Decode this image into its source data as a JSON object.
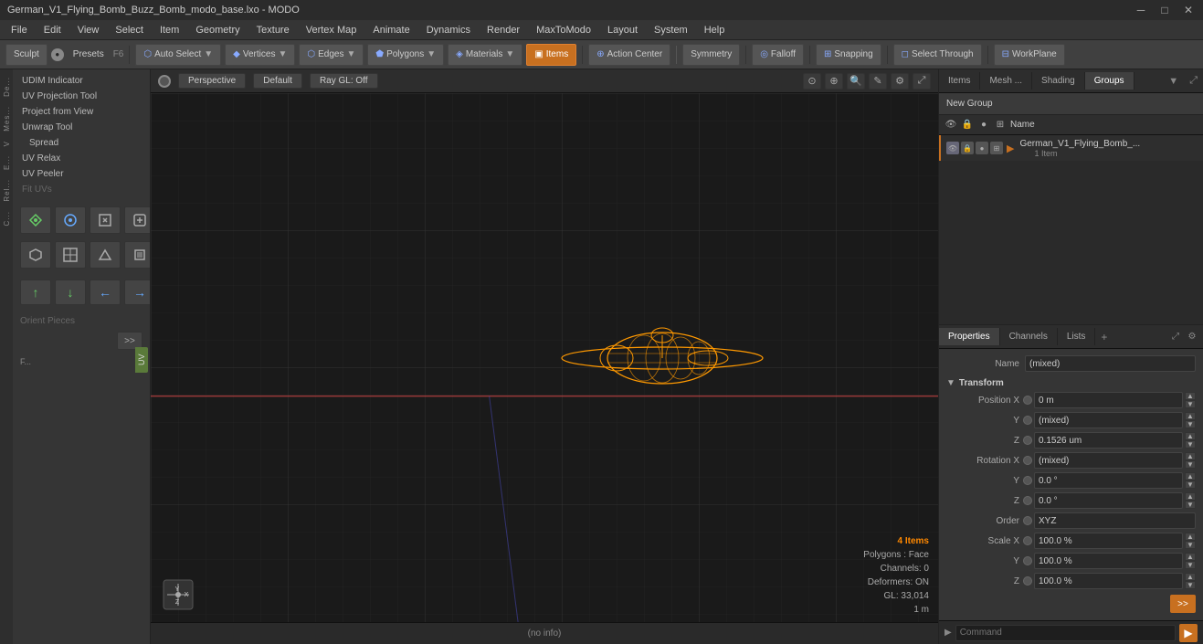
{
  "titlebar": {
    "title": "German_V1_Flying_Bomb_Buzz_Bomb_modo_base.lxo - MODO",
    "controls": [
      "─",
      "□",
      "✕"
    ]
  },
  "menubar": {
    "items": [
      "File",
      "Edit",
      "View",
      "Select",
      "Item",
      "Geometry",
      "Texture",
      "Vertex Map",
      "Animate",
      "Dynamics",
      "Render",
      "MaxToModo",
      "Layout",
      "System",
      "Help"
    ]
  },
  "toolbar": {
    "sculpt_label": "Sculpt",
    "presets_label": "Presets",
    "presets_key": "F6",
    "buttons": [
      {
        "label": "Auto Select",
        "icon": "shield",
        "active": false
      },
      {
        "label": "Vertices",
        "icon": "dot",
        "active": false
      },
      {
        "label": "Edges",
        "icon": "edge",
        "active": false
      },
      {
        "label": "Polygons",
        "icon": "poly",
        "active": false
      },
      {
        "label": "Materials",
        "icon": "mat",
        "active": false
      },
      {
        "label": "Items",
        "icon": "items",
        "active": true
      },
      {
        "label": "Action Center",
        "icon": "ac",
        "active": false
      },
      {
        "label": "Symmetry",
        "icon": "sym",
        "active": false
      },
      {
        "label": "Falloff",
        "icon": "fall",
        "active": false
      },
      {
        "label": "Snapping",
        "icon": "snap",
        "active": false
      },
      {
        "label": "Select Through",
        "icon": "sel",
        "active": false
      },
      {
        "label": "WorkPlane",
        "icon": "wp",
        "active": false
      }
    ]
  },
  "left_panel": {
    "tools": [
      {
        "label": "UDIM Indicator",
        "disabled": false
      },
      {
        "label": "UV Projection Tool",
        "disabled": false
      },
      {
        "label": "Project from View",
        "disabled": false
      },
      {
        "label": "Unwrap Tool",
        "disabled": false
      },
      {
        "label": "Spread",
        "disabled": false
      },
      {
        "label": "UV Relax",
        "disabled": false
      },
      {
        "label": "UV Peeler",
        "disabled": false
      },
      {
        "label": "Fit UVs",
        "disabled": true
      }
    ],
    "orient_label": "Orient Pieces",
    "side_tabs": [
      "De...",
      "Mes...",
      "V",
      "E...",
      "Rel...",
      "C..."
    ],
    "uv_label": "UV"
  },
  "viewport": {
    "perspective_label": "Perspective",
    "default_label": "Default",
    "ray_gl_label": "Ray GL: Off",
    "status": {
      "items": "4 Items",
      "polygons": "Polygons : Face",
      "channels": "Channels: 0",
      "deformers": "Deformers: ON",
      "gl": "GL: 33,014",
      "scale": "1 m"
    },
    "no_info": "(no info)"
  },
  "right_panel": {
    "top_tabs": [
      "Items",
      "Mesh ...",
      "Shading",
      "Groups"
    ],
    "active_top_tab": "Groups",
    "new_group_label": "New Group",
    "item_list_header": {
      "name_label": "Name"
    },
    "items": [
      {
        "name": "German_V1_Flying_Bomb_...",
        "sub": "1 Item",
        "selected": false
      }
    ]
  },
  "properties": {
    "tabs": [
      "Properties",
      "Channels",
      "Lists"
    ],
    "active_tab": "Properties",
    "name_label": "Name",
    "name_value": "(mixed)",
    "transform_label": "Transform",
    "fields": [
      {
        "group": "Position",
        "axis": "X",
        "value": "0 m",
        "dot_active": false
      },
      {
        "group": "",
        "axis": "Y",
        "value": "(mixed)",
        "dot_active": false
      },
      {
        "group": "",
        "axis": "Z",
        "value": "0.1526 um",
        "dot_active": false
      },
      {
        "group": "Rotation",
        "axis": "X",
        "value": "(mixed)",
        "dot_active": false
      },
      {
        "group": "",
        "axis": "Y",
        "value": "0.0 °",
        "dot_active": false
      },
      {
        "group": "",
        "axis": "Z",
        "value": "0.0 °",
        "dot_active": false
      },
      {
        "group": "Order",
        "axis": "",
        "value": "XYZ",
        "dot_active": false
      },
      {
        "group": "Scale",
        "axis": "X",
        "value": "100.0 %",
        "dot_active": false
      },
      {
        "group": "",
        "axis": "Y",
        "value": "100.0 %",
        "dot_active": false
      },
      {
        "group": "",
        "axis": "Z",
        "value": "100.0 %",
        "dot_active": false
      }
    ]
  },
  "command_bar": {
    "placeholder": "Command",
    "arrow_label": "▶"
  }
}
